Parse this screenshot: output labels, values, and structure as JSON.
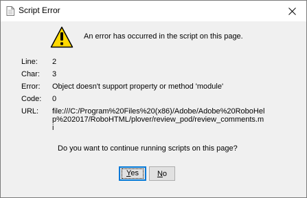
{
  "window": {
    "title": "Script Error",
    "close_symbol": "×"
  },
  "message": "An error has occurred in the script on this page.",
  "details": {
    "line_label": "Line:",
    "line_value": "2",
    "char_label": "Char:",
    "char_value": "3",
    "error_label": "Error:",
    "error_value": "Object doesn't support property or method 'module'",
    "code_label": "Code:",
    "code_value": "0",
    "url_label": "URL:",
    "url_value": "file:///C:/Program%20Files%20(x86)/Adobe/Adobe%20RoboHelp%202017/RoboHTML/plover/review_pod/review_comments.mi"
  },
  "question": "Do you want to continue running scripts on this page?",
  "buttons": {
    "yes_label": "Yes",
    "no_label": "No"
  },
  "icons": {
    "title": "document-icon",
    "warning": "warning-icon",
    "close": "close-icon"
  },
  "colors": {
    "warning_yellow": "#ffd800",
    "focus_border": "#0078d7"
  }
}
